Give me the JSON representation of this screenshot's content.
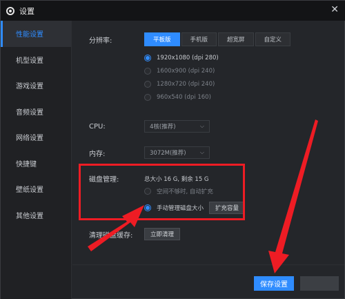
{
  "window": {
    "title": "设置"
  },
  "sidebar": {
    "items": [
      {
        "label": "性能设置",
        "active": true
      },
      {
        "label": "机型设置"
      },
      {
        "label": "游戏设置"
      },
      {
        "label": "音频设置"
      },
      {
        "label": "网络设置"
      },
      {
        "label": "快捷键"
      },
      {
        "label": "壁纸设置"
      },
      {
        "label": "其他设置"
      }
    ]
  },
  "resolution": {
    "label": "分辨率:",
    "tabs": [
      "平板版",
      "手机版",
      "超宽屏",
      "自定义"
    ],
    "options": [
      "1920x1080 (dpi 280)",
      "1600x900 (dpi 240)",
      "1280x720 (dpi 240)",
      "960x540 (dpi 160)"
    ]
  },
  "cpu": {
    "label": "CPU:",
    "value": "4核(推荐)"
  },
  "memory": {
    "label": "内存:",
    "value": "3072M(推荐)"
  },
  "disk": {
    "label": "磁盘管理:",
    "summary": "总大小 16 G, 剩余 15 G",
    "option_auto": "空间不够时, 自动扩充",
    "option_manual": "手动管理磁盘大小",
    "expand_button": "扩充容量"
  },
  "cache": {
    "label": "清理磁盘缓存:",
    "button": "立即清理"
  },
  "footer": {
    "save": "保存设置"
  },
  "colors": {
    "accent": "#2f8cff",
    "annotation": "#ee1c24"
  }
}
